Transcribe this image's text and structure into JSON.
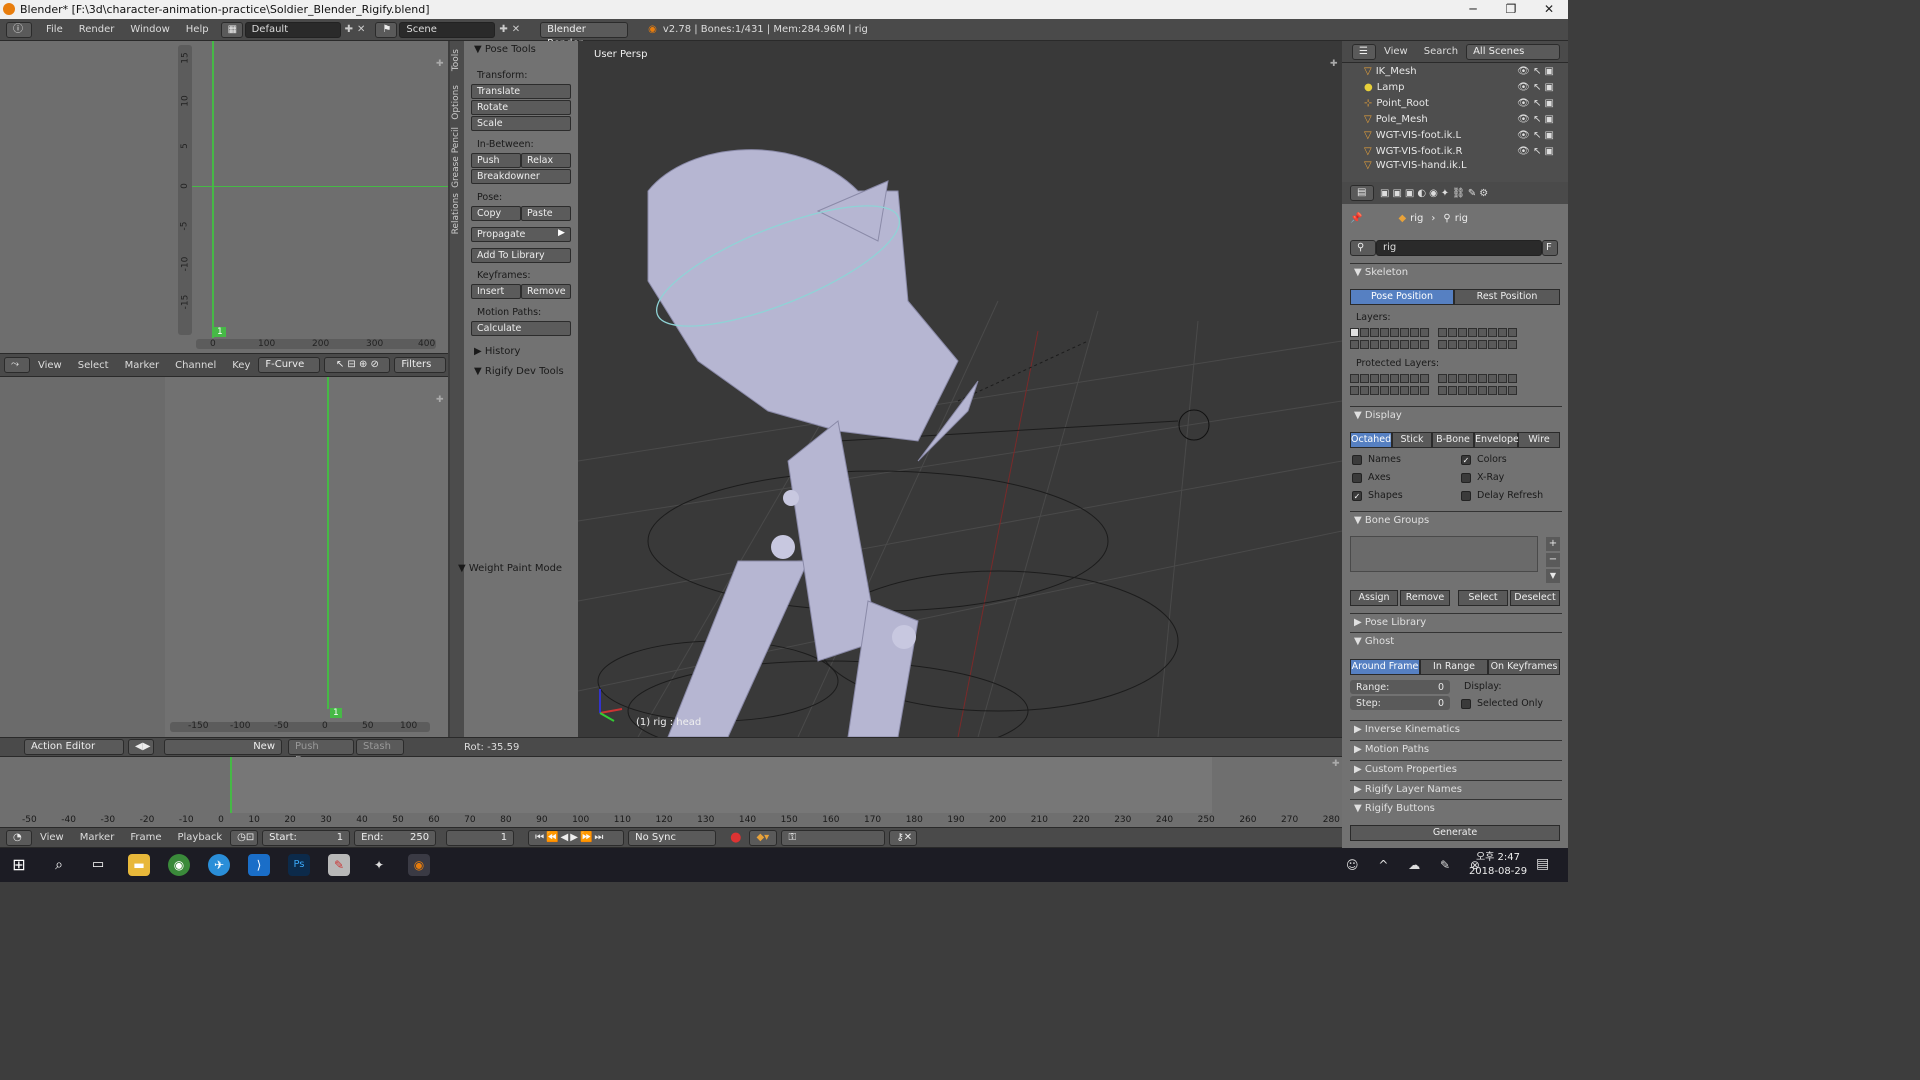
{
  "title": "Blender* [F:\\3d\\character-animation-practice\\Soldier_Blender_Rigify.blend]",
  "window_controls": {
    "min": "─",
    "max": "❐",
    "close": "✕"
  },
  "infobar": {
    "menus": [
      "File",
      "Render",
      "Window",
      "Help"
    ],
    "layout": "Default",
    "scene": "Scene",
    "engine": "Blender Render",
    "stats": "v2.78 | Bones:1/431 | Mem:284.96M | rig"
  },
  "graph_top": {
    "y_ticks": [
      "15",
      "10",
      "5",
      "0",
      "-5",
      "-10",
      "-15"
    ],
    "x_ticks": [
      "0",
      "100",
      "200",
      "300",
      "400"
    ],
    "frame_marker": "1"
  },
  "graph_header": {
    "menus": [
      "View",
      "Select",
      "Marker",
      "Channel",
      "Key"
    ],
    "mode": "F-Curve",
    "filters": "Filters"
  },
  "graph_bottom": {
    "x_ticks": [
      "-150",
      "-100",
      "-50",
      "0",
      "50",
      "100"
    ],
    "frame_marker": "1"
  },
  "action_header": {
    "editor": "Action Editor",
    "new": "New",
    "push_down": "Push Down",
    "stash": "Stash"
  },
  "tool_tabs": [
    "Tools",
    "Options",
    "Grease Pencil",
    "Relations"
  ],
  "tools": {
    "header": "Pose Tools",
    "transform_label": "Transform:",
    "translate": "Translate",
    "rotate": "Rotate",
    "scale": "Scale",
    "inbetween_label": "In-Between:",
    "push": "Push",
    "relax": "Relax",
    "breakdowner": "Breakdowner",
    "pose_label": "Pose:",
    "copy": "Copy",
    "paste": "Paste",
    "propagate": "Propagate",
    "add_to_library": "Add To Library",
    "keyframes_label": "Keyframes:",
    "insert": "Insert",
    "remove": "Remove",
    "motion_paths_label": "Motion Paths:",
    "calculate": "Calculate",
    "history": "History",
    "rigify_dev": "Rigify Dev Tools",
    "weight_paint": "Weight Paint Mode"
  },
  "viewport": {
    "label": "User Persp",
    "object": "(1) rig : head",
    "rot": "Rot: -35.59"
  },
  "outliner": {
    "menus": [
      "View",
      "Search"
    ],
    "scenes": "All Scenes",
    "items": [
      "IK_Mesh",
      "Lamp",
      "Point_Root",
      "Pole_Mesh",
      "WGT-VIS-foot.ik.L",
      "WGT-VIS-foot.ik.R",
      "WGT-VIS-hand.ik.L"
    ]
  },
  "properties": {
    "breadcrumb": [
      "rig",
      "rig"
    ],
    "name": "rig",
    "f_btn": "F",
    "skeleton": "Skeleton",
    "pose_position": "Pose Position",
    "rest_position": "Rest Position",
    "layers": "Layers:",
    "protected_layers": "Protected Layers:",
    "display": "Display",
    "display_modes": [
      "Octahedral",
      "Stick",
      "B-Bone",
      "Envelope",
      "Wire"
    ],
    "names": "Names",
    "colors": "Colors",
    "axes": "Axes",
    "xray": "X-Ray",
    "shapes": "Shapes",
    "delay_refresh": "Delay Refresh",
    "bone_groups": "Bone Groups",
    "assign": "Assign",
    "remove": "Remove",
    "select": "Select",
    "deselect": "Deselect",
    "pose_library": "Pose Library",
    "ghost": "Ghost",
    "ghost_modes": [
      "Around Frame",
      "In Range",
      "On Keyframes"
    ],
    "range_label": "Range:",
    "range_val": "0",
    "step_label": "Step:",
    "step_val": "0",
    "display_label": "Display:",
    "selected_only": "Selected Only",
    "inverse_kinematics": "Inverse Kinematics",
    "motion_paths": "Motion Paths",
    "custom_properties": "Custom Properties",
    "rigify_layer_names": "Rigify Layer Names",
    "rigify_buttons": "Rigify Buttons",
    "generate": "Generate"
  },
  "timeline": {
    "ticks": [
      "-50",
      "-40",
      "-30",
      "-20",
      "-10",
      "0",
      "10",
      "20",
      "30",
      "40",
      "50",
      "60",
      "70",
      "80",
      "90",
      "100",
      "110",
      "120",
      "130",
      "140",
      "150",
      "160",
      "170",
      "180",
      "190",
      "200",
      "210",
      "220",
      "230",
      "240",
      "250",
      "260",
      "270",
      "280"
    ],
    "menus": [
      "View",
      "Marker",
      "Frame",
      "Playback"
    ],
    "start_label": "Start:",
    "start": "1",
    "end_label": "End:",
    "end": "250",
    "current": "1",
    "sync": "No Sync"
  },
  "taskbar": {
    "time": "오후 2:47",
    "date": "2018-08-29"
  }
}
